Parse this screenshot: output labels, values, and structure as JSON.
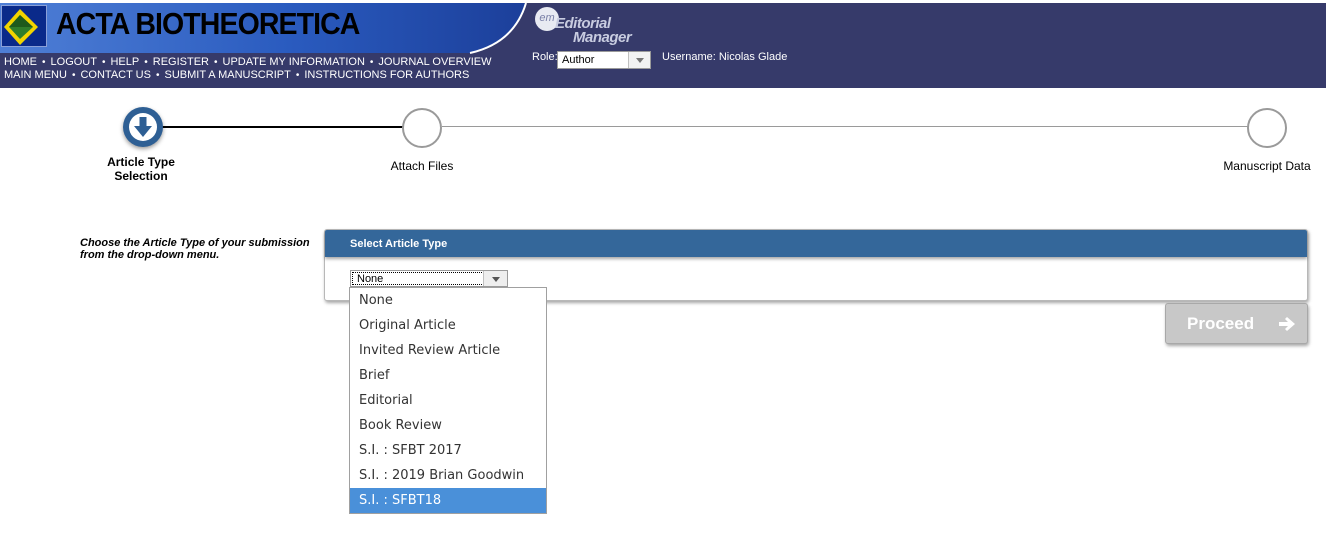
{
  "header": {
    "journal_title": "ACTA BIOTHEORETICA",
    "em_logo_badge": "em",
    "em_logo_line1": "Editorial",
    "em_logo_line2": "Manager",
    "role_label": "Role:",
    "role_value": "Author",
    "username": "Username: Nicolas Glade",
    "nav_row1": [
      "HOME",
      "LOGOUT",
      "HELP",
      "REGISTER",
      "UPDATE MY INFORMATION",
      "JOURNAL OVERVIEW"
    ],
    "nav_row2": [
      "MAIN MENU",
      "CONTACT US",
      "SUBMIT A MANUSCRIPT",
      "INSTRUCTIONS FOR AUTHORS"
    ],
    "colors": {
      "header_bg": "#363a6a",
      "banner_blue": "#1d4fb0"
    }
  },
  "stepper": {
    "steps": [
      {
        "label": "Article Type Selection",
        "status": "current"
      },
      {
        "label": "Attach Files",
        "status": "pending"
      },
      {
        "label": "Manuscript Data",
        "status": "pending"
      }
    ],
    "active_color": "#2e5f94"
  },
  "form": {
    "instruction": "Choose the Article Type of your submission from the drop-down menu.",
    "panel_title": "Select Article Type",
    "select_value": "None",
    "options": [
      "None",
      "Original Article",
      "Invited Review Article",
      "Brief",
      "Editorial",
      "Book Review",
      "S.I. : SFBT 2017",
      "S.I. : 2019 Brian Goodwin",
      "S.I. : SFBT18"
    ],
    "highlighted_option": "S.I. : SFBT18",
    "proceed_label": "Proceed",
    "panel_color": "#34679a",
    "highlight_color": "#4a90d9"
  }
}
